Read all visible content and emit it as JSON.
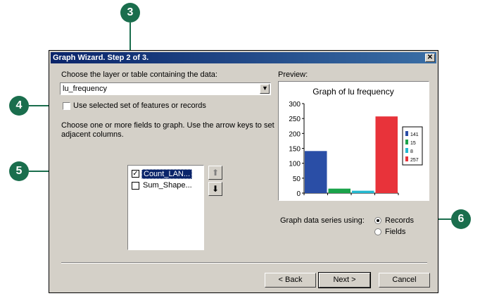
{
  "dialog": {
    "title": "Graph Wizard. Step 2 of 3.",
    "close_glyph": "✕",
    "layer_label": "Choose the layer or table containing the data:",
    "layer_value": "lu_frequency",
    "use_selected_label": "Use selected set of features or records",
    "fields_instructions": "Choose one or more fields to graph. Use the arrow keys to set adjacent columns.",
    "fields": [
      {
        "label": "Count_LAN...",
        "checked": true
      },
      {
        "label": "Sum_Shape...",
        "checked": false
      }
    ],
    "preview_label": "Preview:",
    "series_label": "Graph data series using:",
    "series_options": [
      "Records",
      "Fields"
    ],
    "series_selected": "Records",
    "buttons": {
      "back": "< Back",
      "next": "Next >",
      "cancel": "Cancel"
    }
  },
  "callouts": [
    "3",
    "4",
    "5",
    "6"
  ],
  "chart_data": {
    "type": "bar",
    "title": "Graph of lu frequency",
    "categories": [
      "141",
      "15",
      "8",
      "257"
    ],
    "values": [
      141,
      15,
      8,
      257
    ],
    "colors": [
      "#2a4ea6",
      "#1aa34a",
      "#24b8d0",
      "#e8333a"
    ],
    "yticks": [
      "0",
      "50",
      "100",
      "150",
      "200",
      "250",
      "300"
    ],
    "ylim": [
      0,
      300
    ],
    "legend": [
      "141",
      "15",
      "8",
      "257"
    ],
    "legend_position": "right"
  }
}
